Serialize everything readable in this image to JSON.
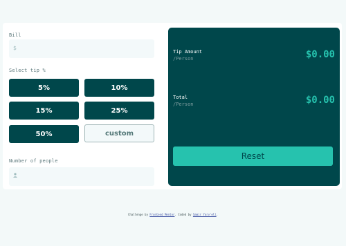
{
  "bill": {
    "label": "Bill",
    "icon": "dollar-icon",
    "icon_glyph": "$",
    "value": ""
  },
  "tips": {
    "label": "Select tip %",
    "options": [
      "5%",
      "10%",
      "15%",
      "25%",
      "50%"
    ],
    "custom_placeholder": "custom"
  },
  "people": {
    "label": "Number of people",
    "icon": "person-icon",
    "value": ""
  },
  "summary": {
    "tip_title": "Tip Amount",
    "tip_sub": "/Person",
    "tip_value": "$0.00",
    "total_title": "Total",
    "total_sub": "/Person",
    "total_value": "$0.00",
    "reset_label": "Reset"
  },
  "footer": {
    "prefix": "Challenge by ",
    "fm_link": "Frontend Mentor",
    "middle": ". Coded by ",
    "author_link": "Samir Yorv'ell",
    "suffix": "."
  },
  "colors": {
    "accent": "#26c2ae",
    "dark": "#00474b",
    "background": "#f3f9f9"
  }
}
